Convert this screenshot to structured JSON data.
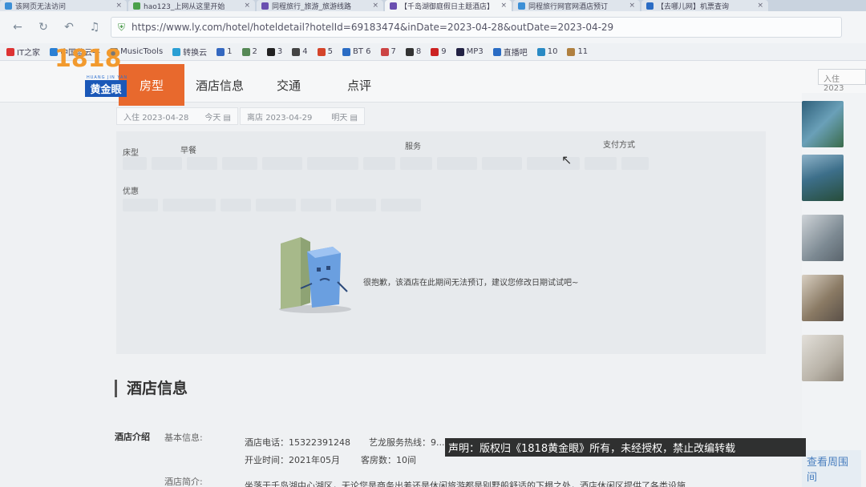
{
  "browser": {
    "tabs": [
      {
        "title": "该网页无法访问",
        "active": false,
        "color": "#3c8fd6"
      },
      {
        "title": "hao123_上网从这里开始",
        "active": false,
        "color": "#4aa04a"
      },
      {
        "title": "同程旅行_旅游_旅游线路",
        "active": false,
        "color": "#6a4fb0"
      },
      {
        "title": "【千岛湖御庭假日主题酒店】",
        "active": true,
        "color": "#6a4fb0"
      },
      {
        "title": "同程旅行网官网酒店预订",
        "active": false,
        "color": "#3c8fd6"
      },
      {
        "title": "【去哪儿网】机票查询",
        "active": false,
        "color": "#2a6cc4"
      }
    ],
    "url": "https://www.ly.com/hotel/hoteldetail?hotelId=69183474&inDate=2023-04-28&outDate=2023-04-29",
    "bookmarks": [
      {
        "label": "IT之家",
        "color": "#d33"
      },
      {
        "label": "中国蓝云平",
        "color": "#2a7fd4"
      },
      {
        "label": "MusicTools",
        "color": "#777"
      },
      {
        "label": "转换云",
        "color": "#2a9fd4"
      },
      {
        "label": "1",
        "color": "#3468c0"
      },
      {
        "label": "2",
        "color": "#558855"
      },
      {
        "label": "3",
        "color": "#222"
      },
      {
        "label": "4",
        "color": "#444"
      },
      {
        "label": "5",
        "color": "#d4442a"
      },
      {
        "label": "BT 6",
        "color": "#2a6cc4"
      },
      {
        "label": "7",
        "color": "#c44"
      },
      {
        "label": "8",
        "color": "#333"
      },
      {
        "label": "9",
        "color": "#c22"
      },
      {
        "label": "MP3",
        "color": "#224"
      },
      {
        "label": "直播吧",
        "color": "#2a6cc4"
      },
      {
        "label": "10",
        "color": "#2a8ac4"
      },
      {
        "label": "11",
        "color": "#b08040"
      }
    ]
  },
  "page": {
    "nav_tabs": [
      "房型",
      "酒店信息",
      "交通",
      "点评"
    ],
    "search_placeholder": "入住 2023",
    "dates": {
      "checkin_label": "入住",
      "checkin_date": "2023-04-28",
      "checkin_day": "今天",
      "checkout_label": "离店",
      "checkout_date": "2023-04-29",
      "checkout_day": "明天"
    },
    "filters": {
      "room_type": "床型",
      "breakfast": "早餐",
      "services": "服务",
      "payment": "支付方式",
      "discount": "优惠"
    },
    "empty_message": "很抱歉，该酒店在此期间无法预订，建议您修改日期试试吧~",
    "section_title": "酒店信息",
    "hotel_intro": {
      "label": "酒店介绍",
      "basic_info": "基本信息:",
      "phone": "酒店电话：15322391248",
      "elong_hotline": "艺龙服务热线：9...",
      "opened": "开业时间：2021年05月",
      "rooms": "客房数：10间",
      "brief_label": "酒店简介:",
      "brief_text": "坐落于千岛湖中心湖区，无论您是商务出差还是休闲旅游都是别墅般舒适的下榻之处，酒店休闲区提供了各类设施"
    },
    "sidebar": {
      "nearby": "查看周围间"
    }
  },
  "watermark": {
    "logo_digits": "1818",
    "logo_text": "黄金眼",
    "logo_pinyin": "HUANG JIN YAN"
  },
  "notice": "声明：版权归《1818黄金眼》所有，未经授权，禁止改编转载"
}
